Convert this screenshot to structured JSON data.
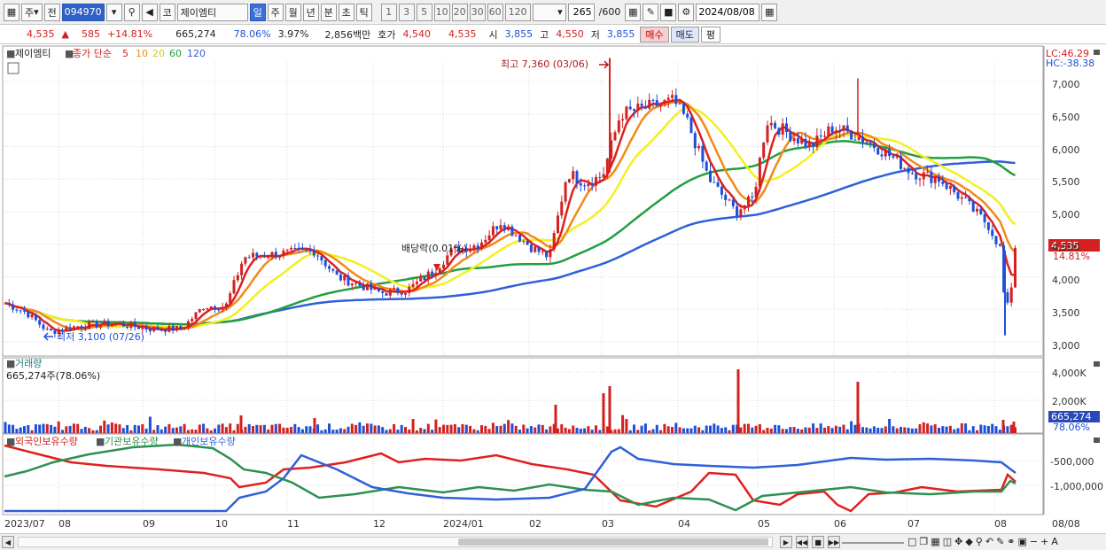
{
  "toolbar": {
    "market": "주",
    "prev_label": "전",
    "code": "094970",
    "kospi_label": "코",
    "stock_name": "제이엠티",
    "periods": [
      "일",
      "주",
      "월",
      "년",
      "분",
      "초",
      "틱"
    ],
    "active_period": "일",
    "intervals": [
      "1",
      "3",
      "5",
      "10",
      "20",
      "30",
      "60",
      "120"
    ],
    "count": "265",
    "count_total": "/600",
    "date": "2024/08/08"
  },
  "quote": {
    "price": "4,535",
    "change": "585",
    "change_pct": "+14.81%",
    "volume": "665,274",
    "vol_ratio": "78.06%",
    "turnover": "3.97%",
    "amount": "2,856백만",
    "hoga_label": "호가",
    "ask": "4,540",
    "bid": "4,535",
    "open_label": "시",
    "open": "3,855",
    "high_label": "고",
    "high": "4,550",
    "low_label": "저",
    "low": "3,855",
    "buy_label": "매수",
    "sell_label": "매도",
    "eval_label": "평"
  },
  "colors": {
    "up": "#d42020",
    "down": "#1f4fd8",
    "ma5": "#e02020",
    "ma10": "#f08a18",
    "ma20": "#f2f020",
    "ma60": "#22a040",
    "ma120": "#3060d8",
    "foreign": "#e02020",
    "inst": "#2e9050",
    "indiv": "#3060d8"
  },
  "price_panel": {
    "name": "제이엠티",
    "ma_label": "종가 단순",
    "ma_periods": [
      "5",
      "10",
      "20",
      "60",
      "120"
    ],
    "lc": "LC:46.29",
    "hc": "HC:-38.38",
    "high_note": "최고 7,360 (03/06)",
    "low_note": "최저 3,100 (07/26)",
    "dividend_note": "배당락(0.01%)",
    "price_tag": "4,535",
    "pct_tag": "14.81%",
    "ticks": [
      "7,000",
      "6,500",
      "6,000",
      "5,500",
      "5,000",
      "4,500",
      "4,000",
      "3,500",
      "3,000"
    ]
  },
  "volume_panel": {
    "title": "거래량",
    "value": "665,274주(78.06%)",
    "ticks": [
      "4,000K",
      "2,000K"
    ],
    "tag": "665,274",
    "tag_pct": "78.06%"
  },
  "holding_panel": {
    "legend": [
      "외국인보유수량",
      "기관보유수량",
      "개인보유수량"
    ],
    "ticks": [
      "-500,000",
      "-1,000,000"
    ]
  },
  "x_axis": {
    "labels": [
      "2023/07",
      "08",
      "09",
      "10",
      "11",
      "12",
      "2024/01",
      "02",
      "03",
      "04",
      "05",
      "06",
      "07",
      "08"
    ],
    "end_label": "08/08"
  },
  "chart_data": {
    "type": "candlestick",
    "period": "2023/07 - 2024/08/08",
    "y_ticks": [
      3000,
      3500,
      4000,
      4500,
      5000,
      5500,
      6000,
      6500,
      7000
    ],
    "series": [
      {
        "name": "종가",
        "points": [
          [
            "2023/07",
            3600
          ],
          [
            "2023/08",
            3250
          ],
          [
            "2023/09",
            3200
          ],
          [
            "2023/10",
            3550
          ],
          [
            "2023/10-late",
            4300
          ],
          [
            "2023/11",
            4350
          ],
          [
            "2023/11-mid",
            4000
          ],
          [
            "2023/12",
            3750
          ],
          [
            "2023/12-late",
            4100
          ],
          [
            "2024/01",
            4500
          ],
          [
            "2024/01-late",
            4800
          ],
          [
            "2024/02",
            4300
          ],
          [
            "2024/02-mid",
            5600
          ],
          [
            "2024/02-late",
            5400
          ],
          [
            "2024/03",
            6300
          ],
          [
            "2024/03-mid",
            6700
          ],
          [
            "2024/04",
            6600
          ],
          [
            "2024/04-mid",
            5200
          ],
          [
            "2024/04-late",
            5000
          ],
          [
            "2024/05",
            6400
          ],
          [
            "2024/05-mid",
            6000
          ],
          [
            "2024/06",
            6300
          ],
          [
            "2024/06-mid",
            6200
          ],
          [
            "2024/07",
            5700
          ],
          [
            "2024/07-mid",
            5400
          ],
          [
            "2024/08",
            4900
          ],
          [
            "2024/08-early",
            3400
          ],
          [
            "2024/08/08",
            4535
          ]
        ]
      }
    ],
    "high": {
      "value": 7360,
      "date": "03/06"
    },
    "low": {
      "value": 3100,
      "date": "07/26"
    },
    "last": {
      "value": 4535,
      "change_pct": 14.81
    },
    "volume_y_ticks": [
      2000000,
      4000000
    ],
    "last_volume": 665274
  }
}
